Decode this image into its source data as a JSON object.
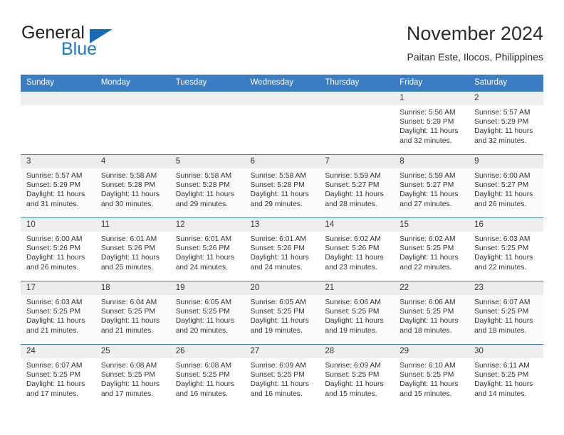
{
  "logo": {
    "word_one": "General",
    "word_two": "Blue",
    "triangle_color": "#1a6bb5",
    "blue_text_color": "#1f7ac4"
  },
  "header": {
    "title": "November 2024",
    "subtitle": "Paitan Este, Ilocos, Philippines"
  },
  "theme": {
    "header_blue": "#3b7dc4",
    "daynum_band": "#efefef",
    "text": "#333333"
  },
  "weekday_headers": [
    "Sunday",
    "Monday",
    "Tuesday",
    "Wednesday",
    "Thursday",
    "Friday",
    "Saturday"
  ],
  "weeks": [
    [
      {
        "day": "",
        "sunrise": "",
        "sunset": "",
        "daylight_line1": "",
        "daylight_line2": ""
      },
      {
        "day": "",
        "sunrise": "",
        "sunset": "",
        "daylight_line1": "",
        "daylight_line2": ""
      },
      {
        "day": "",
        "sunrise": "",
        "sunset": "",
        "daylight_line1": "",
        "daylight_line2": ""
      },
      {
        "day": "",
        "sunrise": "",
        "sunset": "",
        "daylight_line1": "",
        "daylight_line2": ""
      },
      {
        "day": "",
        "sunrise": "",
        "sunset": "",
        "daylight_line1": "",
        "daylight_line2": ""
      },
      {
        "day": "1",
        "sunrise": "Sunrise: 5:56 AM",
        "sunset": "Sunset: 5:29 PM",
        "daylight_line1": "Daylight: 11 hours",
        "daylight_line2": "and 32 minutes."
      },
      {
        "day": "2",
        "sunrise": "Sunrise: 5:57 AM",
        "sunset": "Sunset: 5:29 PM",
        "daylight_line1": "Daylight: 11 hours",
        "daylight_line2": "and 32 minutes."
      }
    ],
    [
      {
        "day": "3",
        "sunrise": "Sunrise: 5:57 AM",
        "sunset": "Sunset: 5:29 PM",
        "daylight_line1": "Daylight: 11 hours",
        "daylight_line2": "and 31 minutes."
      },
      {
        "day": "4",
        "sunrise": "Sunrise: 5:58 AM",
        "sunset": "Sunset: 5:28 PM",
        "daylight_line1": "Daylight: 11 hours",
        "daylight_line2": "and 30 minutes."
      },
      {
        "day": "5",
        "sunrise": "Sunrise: 5:58 AM",
        "sunset": "Sunset: 5:28 PM",
        "daylight_line1": "Daylight: 11 hours",
        "daylight_line2": "and 29 minutes."
      },
      {
        "day": "6",
        "sunrise": "Sunrise: 5:58 AM",
        "sunset": "Sunset: 5:28 PM",
        "daylight_line1": "Daylight: 11 hours",
        "daylight_line2": "and 29 minutes."
      },
      {
        "day": "7",
        "sunrise": "Sunrise: 5:59 AM",
        "sunset": "Sunset: 5:27 PM",
        "daylight_line1": "Daylight: 11 hours",
        "daylight_line2": "and 28 minutes."
      },
      {
        "day": "8",
        "sunrise": "Sunrise: 5:59 AM",
        "sunset": "Sunset: 5:27 PM",
        "daylight_line1": "Daylight: 11 hours",
        "daylight_line2": "and 27 minutes."
      },
      {
        "day": "9",
        "sunrise": "Sunrise: 6:00 AM",
        "sunset": "Sunset: 5:27 PM",
        "daylight_line1": "Daylight: 11 hours",
        "daylight_line2": "and 26 minutes."
      }
    ],
    [
      {
        "day": "10",
        "sunrise": "Sunrise: 6:00 AM",
        "sunset": "Sunset: 5:26 PM",
        "daylight_line1": "Daylight: 11 hours",
        "daylight_line2": "and 26 minutes."
      },
      {
        "day": "11",
        "sunrise": "Sunrise: 6:01 AM",
        "sunset": "Sunset: 5:26 PM",
        "daylight_line1": "Daylight: 11 hours",
        "daylight_line2": "and 25 minutes."
      },
      {
        "day": "12",
        "sunrise": "Sunrise: 6:01 AM",
        "sunset": "Sunset: 5:26 PM",
        "daylight_line1": "Daylight: 11 hours",
        "daylight_line2": "and 24 minutes."
      },
      {
        "day": "13",
        "sunrise": "Sunrise: 6:01 AM",
        "sunset": "Sunset: 5:26 PM",
        "daylight_line1": "Daylight: 11 hours",
        "daylight_line2": "and 24 minutes."
      },
      {
        "day": "14",
        "sunrise": "Sunrise: 6:02 AM",
        "sunset": "Sunset: 5:26 PM",
        "daylight_line1": "Daylight: 11 hours",
        "daylight_line2": "and 23 minutes."
      },
      {
        "day": "15",
        "sunrise": "Sunrise: 6:02 AM",
        "sunset": "Sunset: 5:25 PM",
        "daylight_line1": "Daylight: 11 hours",
        "daylight_line2": "and 22 minutes."
      },
      {
        "day": "16",
        "sunrise": "Sunrise: 6:03 AM",
        "sunset": "Sunset: 5:25 PM",
        "daylight_line1": "Daylight: 11 hours",
        "daylight_line2": "and 22 minutes."
      }
    ],
    [
      {
        "day": "17",
        "sunrise": "Sunrise: 6:03 AM",
        "sunset": "Sunset: 5:25 PM",
        "daylight_line1": "Daylight: 11 hours",
        "daylight_line2": "and 21 minutes."
      },
      {
        "day": "18",
        "sunrise": "Sunrise: 6:04 AM",
        "sunset": "Sunset: 5:25 PM",
        "daylight_line1": "Daylight: 11 hours",
        "daylight_line2": "and 21 minutes."
      },
      {
        "day": "19",
        "sunrise": "Sunrise: 6:05 AM",
        "sunset": "Sunset: 5:25 PM",
        "daylight_line1": "Daylight: 11 hours",
        "daylight_line2": "and 20 minutes."
      },
      {
        "day": "20",
        "sunrise": "Sunrise: 6:05 AM",
        "sunset": "Sunset: 5:25 PM",
        "daylight_line1": "Daylight: 11 hours",
        "daylight_line2": "and 19 minutes."
      },
      {
        "day": "21",
        "sunrise": "Sunrise: 6:06 AM",
        "sunset": "Sunset: 5:25 PM",
        "daylight_line1": "Daylight: 11 hours",
        "daylight_line2": "and 19 minutes."
      },
      {
        "day": "22",
        "sunrise": "Sunrise: 6:06 AM",
        "sunset": "Sunset: 5:25 PM",
        "daylight_line1": "Daylight: 11 hours",
        "daylight_line2": "and 18 minutes."
      },
      {
        "day": "23",
        "sunrise": "Sunrise: 6:07 AM",
        "sunset": "Sunset: 5:25 PM",
        "daylight_line1": "Daylight: 11 hours",
        "daylight_line2": "and 18 minutes."
      }
    ],
    [
      {
        "day": "24",
        "sunrise": "Sunrise: 6:07 AM",
        "sunset": "Sunset: 5:25 PM",
        "daylight_line1": "Daylight: 11 hours",
        "daylight_line2": "and 17 minutes."
      },
      {
        "day": "25",
        "sunrise": "Sunrise: 6:08 AM",
        "sunset": "Sunset: 5:25 PM",
        "daylight_line1": "Daylight: 11 hours",
        "daylight_line2": "and 17 minutes."
      },
      {
        "day": "26",
        "sunrise": "Sunrise: 6:08 AM",
        "sunset": "Sunset: 5:25 PM",
        "daylight_line1": "Daylight: 11 hours",
        "daylight_line2": "and 16 minutes."
      },
      {
        "day": "27",
        "sunrise": "Sunrise: 6:09 AM",
        "sunset": "Sunset: 5:25 PM",
        "daylight_line1": "Daylight: 11 hours",
        "daylight_line2": "and 16 minutes."
      },
      {
        "day": "28",
        "sunrise": "Sunrise: 6:09 AM",
        "sunset": "Sunset: 5:25 PM",
        "daylight_line1": "Daylight: 11 hours",
        "daylight_line2": "and 15 minutes."
      },
      {
        "day": "29",
        "sunrise": "Sunrise: 6:10 AM",
        "sunset": "Sunset: 5:25 PM",
        "daylight_line1": "Daylight: 11 hours",
        "daylight_line2": "and 15 minutes."
      },
      {
        "day": "30",
        "sunrise": "Sunrise: 6:11 AM",
        "sunset": "Sunset: 5:25 PM",
        "daylight_line1": "Daylight: 11 hours",
        "daylight_line2": "and 14 minutes."
      }
    ]
  ]
}
